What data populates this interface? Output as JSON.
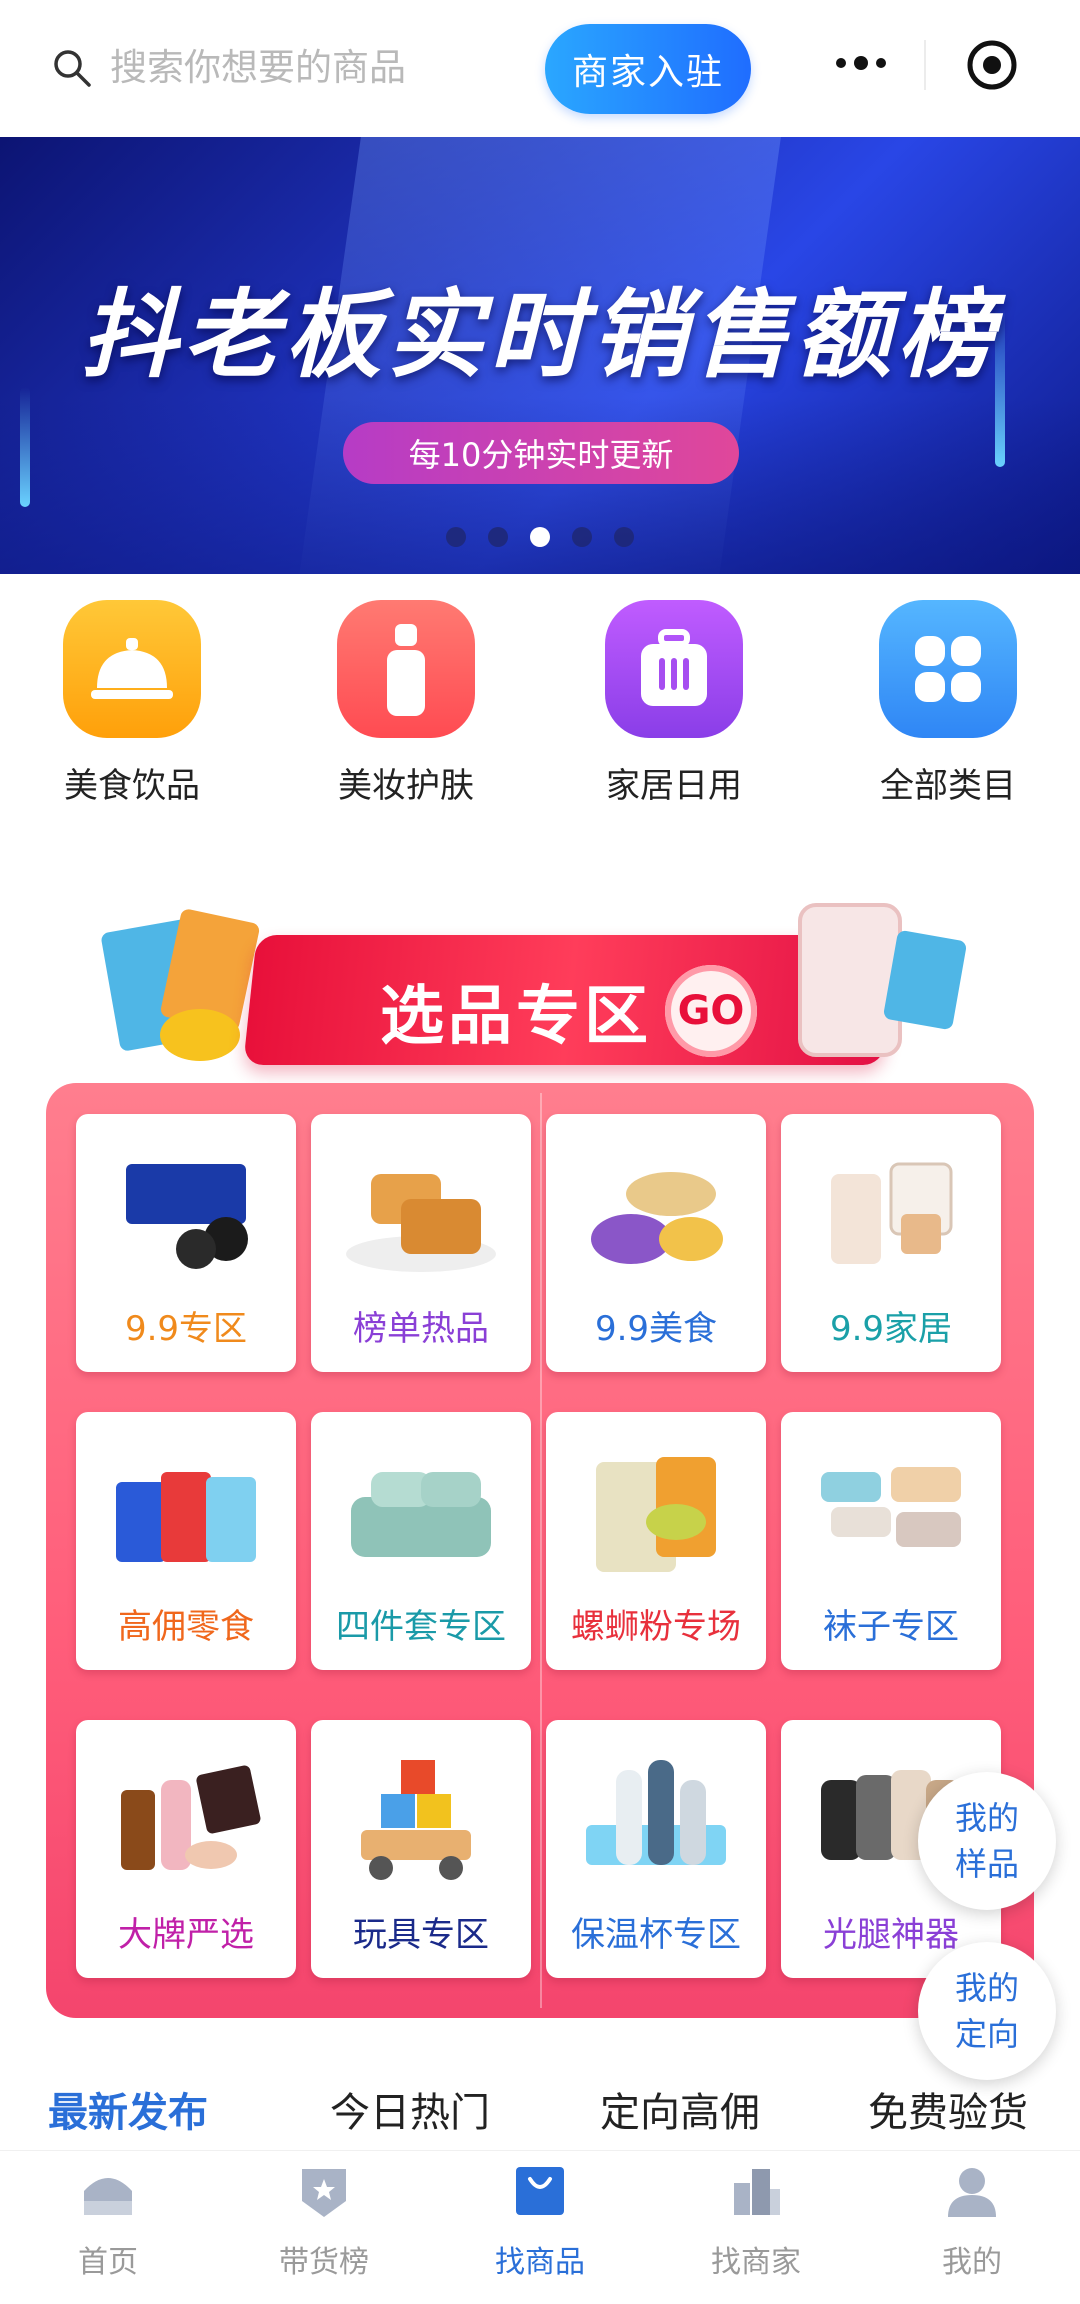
{
  "search": {
    "placeholder": "搜索你想要的商品"
  },
  "header": {
    "merchant_button": "商家入驻"
  },
  "banner": {
    "title": "抖老板实时销售额榜",
    "subtitle": "每10分钟实时更新",
    "page_count": 5,
    "active_page": 3
  },
  "categories": [
    {
      "label": "美食饮品",
      "icon": "service-bell-icon",
      "color": "#ffb21e"
    },
    {
      "label": "美妆护肤",
      "icon": "bottle-icon",
      "color": "#ff5c5c"
    },
    {
      "label": "家居日用",
      "icon": "suitcase-icon",
      "color": "#a64ef0"
    },
    {
      "label": "全部类目",
      "icon": "grid-icon",
      "color": "#3aa0ff"
    }
  ],
  "zone": {
    "title": "选品专区",
    "go": "GO",
    "tiles": [
      {
        "label": "9.9专区",
        "icon": "biscuit-icon",
        "color": "#f08a1c"
      },
      {
        "label": "榜单热品",
        "icon": "bread-icon",
        "color": "#8a3fd6"
      },
      {
        "label": "9.9美食",
        "icon": "snack-icon",
        "color": "#2a6fd8"
      },
      {
        "label": "9.9家居",
        "icon": "socket-icon",
        "color": "#1aa0a8"
      },
      {
        "label": "高佣零食",
        "icon": "chips-icon",
        "color": "#f0671c"
      },
      {
        "label": "四件套专区",
        "icon": "bedding-icon",
        "color": "#1a9aa8"
      },
      {
        "label": "螺蛳粉专场",
        "icon": "noodle-icon",
        "color": "#e8303c"
      },
      {
        "label": "袜子专区",
        "icon": "socks-icon",
        "color": "#2a6fd8"
      },
      {
        "label": "大牌严选",
        "icon": "cosmetics-icon",
        "color": "#c020a8"
      },
      {
        "label": "玩具专区",
        "icon": "toy-blocks-icon",
        "color": "#1a2a8a"
      },
      {
        "label": "保温杯专区",
        "icon": "thermos-icon",
        "color": "#2a6fd8"
      },
      {
        "label": "光腿神器",
        "icon": "stockings-icon",
        "color": "#8a3fd6"
      }
    ]
  },
  "floating": {
    "samples": "我的\n样品",
    "targeted": "我的\n定向"
  },
  "tabs": [
    "最新发布",
    "今日热门",
    "定向高佣",
    "免费验货"
  ],
  "bottom_nav": [
    {
      "label": "首页",
      "icon": "home-icon"
    },
    {
      "label": "带货榜",
      "icon": "badge-icon"
    },
    {
      "label": "找商品",
      "icon": "shopping-bag-icon"
    },
    {
      "label": "找商家",
      "icon": "buildings-icon"
    },
    {
      "label": "我的",
      "icon": "user-icon"
    }
  ],
  "colors": {
    "accent": "#2a6fd8",
    "merchant_button": "#1f6dff",
    "zone": "#ff5d7a"
  }
}
